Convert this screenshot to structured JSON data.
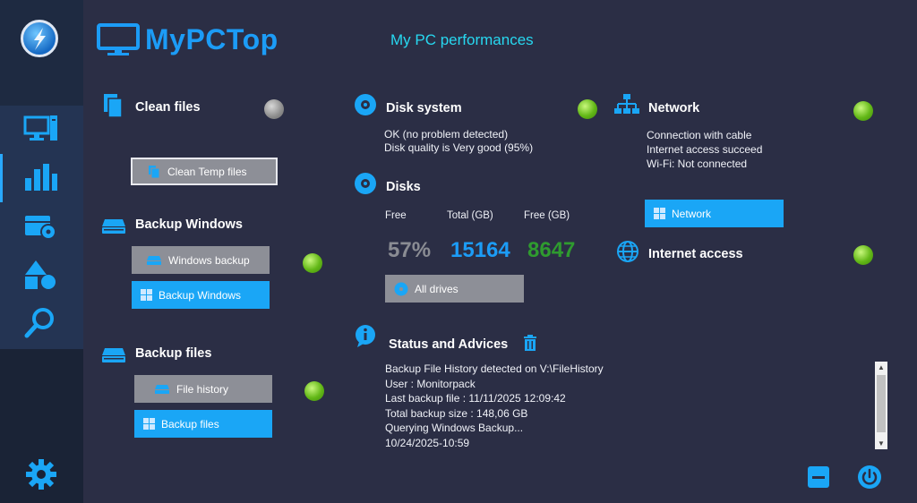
{
  "app": {
    "brand_name": "MyPCTop",
    "subtitle": "My PC performances"
  },
  "sidebar": {
    "items": [
      {
        "name": "computer",
        "icon": "computer-icon"
      },
      {
        "name": "performance",
        "icon": "bar-chart-icon",
        "active": true
      },
      {
        "name": "disk",
        "icon": "disk-drive-icon"
      },
      {
        "name": "shapes",
        "icon": "shapes-icon"
      },
      {
        "name": "search",
        "icon": "magnifier-icon"
      }
    ],
    "settings_icon": "gear-icon"
  },
  "clean_files": {
    "title": "Clean files",
    "button": "Clean Temp files",
    "status": "gray"
  },
  "backup_windows": {
    "title": "Backup Windows",
    "button_primary": "Windows backup",
    "button_secondary": "Backup Windows",
    "status": "green"
  },
  "backup_files": {
    "title": "Backup files",
    "button_primary": "File history",
    "button_secondary": "Backup files",
    "status": "green"
  },
  "disk_system": {
    "title": "Disk system",
    "line1": "OK (no problem detected)",
    "line2": "Disk quality is Very good (95%)",
    "status": "green"
  },
  "disks": {
    "title": "Disks",
    "labels": [
      "Free",
      "Total (GB)",
      "Free (GB)"
    ],
    "free_pct": "57%",
    "total_gb": "15164",
    "free_gb": "8647",
    "button": "All drives"
  },
  "network": {
    "title": "Network",
    "lines": [
      "Connection with cable",
      "Internet access succeed",
      "Wi-Fi: Not connected"
    ],
    "button": "Network",
    "status": "green"
  },
  "internet": {
    "title": "Internet access",
    "status": "green"
  },
  "status_advices": {
    "title": "Status and Advices",
    "lines": [
      "Backup File History detected on V:\\FileHistory",
      "User : Monitorpack",
      "Last backup file : 11/11/2025 12:09:42",
      "Total backup size : 148,06 GB",
      "Querying Windows Backup...",
      "10/24/2025-10:59"
    ]
  },
  "colors": {
    "accent": "#1aa6f6",
    "background": "#2b2e45",
    "free_pct": "#8a8c93",
    "total": "#1c9cf6",
    "free_gb": "#2f9b2f"
  }
}
